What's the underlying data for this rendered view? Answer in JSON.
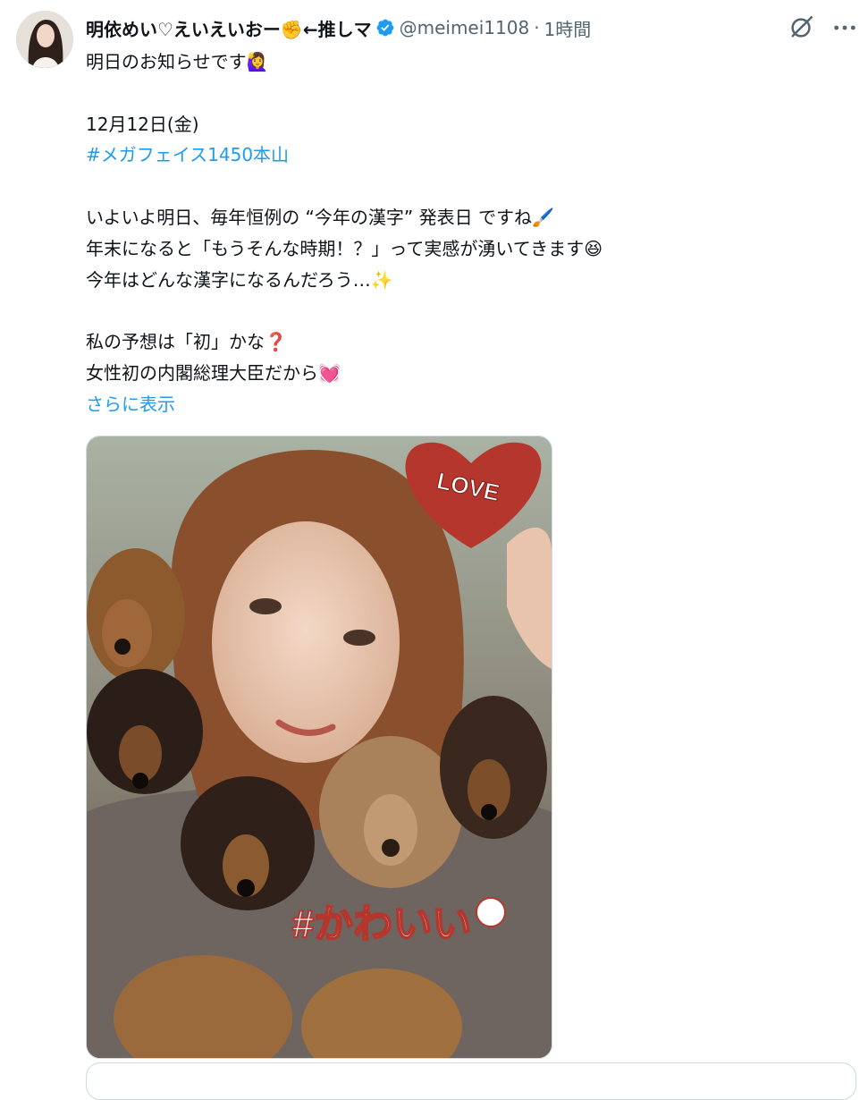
{
  "tweet": {
    "display_name": "明依めい♡えいえいおー✊←推しマ",
    "handle": "@meimei1108",
    "separator": "·",
    "timestamp": "1時間",
    "lines": [
      "明日のお知らせです🙋‍♀️",
      "",
      "12月12日(金)",
      "",
      "",
      "いよいよ明日、毎年恒例の “今年の漢字” 発表日 ですね🖌️",
      "年末になると「もうそんな時期！？」って実感が湧いてきます😆",
      "今年はどんな漢字になるんだろう…✨",
      "",
      "私の予想は「初」かな❓",
      "女性初の内閣総理大臣だから💓"
    ],
    "hashtag": "#メガフェイス1450本山",
    "show_more": "さらに表示"
  },
  "media": {
    "sticker_love": "LOVE",
    "sticker_kawaii": "#かわいい"
  },
  "colors": {
    "link": "#1d9bf0",
    "verified": "#1d9bf0",
    "secondary_text": "#536471"
  },
  "icons": [
    "verified-badge-icon",
    "grok-icon",
    "more-icon"
  ]
}
